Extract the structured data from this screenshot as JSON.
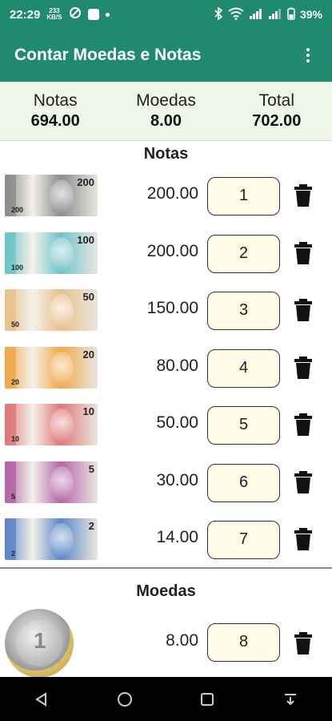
{
  "status_bar": {
    "time": "22:29",
    "notif_badge_top": "233",
    "notif_badge_bottom": "KB/S",
    "battery": "39%"
  },
  "app_bar": {
    "title": "Contar Moedas e Notas"
  },
  "summary": {
    "notas_label": "Notas",
    "notas_value": "694.00",
    "moedas_label": "Moedas",
    "moedas_value": "8.00",
    "total_label": "Total",
    "total_value": "702.00"
  },
  "notas_section": {
    "title": "Notas",
    "rows": [
      {
        "denomination": "200",
        "amount": "200.00",
        "quantity": "1",
        "color": "#8c8c8c"
      },
      {
        "denomination": "100",
        "amount": "200.00",
        "quantity": "2",
        "color": "#6fc3c9"
      },
      {
        "denomination": "50",
        "amount": "150.00",
        "quantity": "3",
        "color": "#e8c08a"
      },
      {
        "denomination": "20",
        "amount": "80.00",
        "quantity": "4",
        "color": "#f0a84a"
      },
      {
        "denomination": "10",
        "amount": "50.00",
        "quantity": "5",
        "color": "#e07878"
      },
      {
        "denomination": "5",
        "amount": "30.00",
        "quantity": "6",
        "color": "#b565a8"
      },
      {
        "denomination": "2",
        "amount": "14.00",
        "quantity": "7",
        "color": "#5b86c8"
      }
    ]
  },
  "moedas_section": {
    "title": "Moedas",
    "rows": [
      {
        "denomination": "1",
        "amount": "8.00",
        "quantity": "8"
      }
    ]
  },
  "colors": {
    "primary": "#1f8a6e",
    "summary_bg": "#eef6e9",
    "qty_bg": "#fffbe6"
  }
}
